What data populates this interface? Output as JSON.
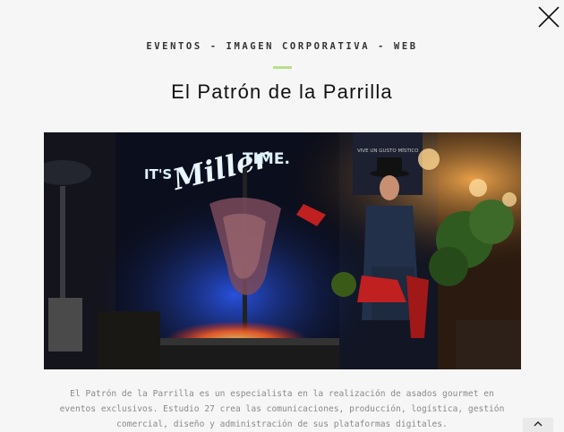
{
  "header": {
    "category": "EVENTOS - IMAGEN CORPORATIVA - WEB",
    "title": "El Patrón de la Parrilla"
  },
  "photo": {
    "neon_sign_line1": "IT'S",
    "neon_sign_line2": "Miller",
    "neon_sign_line3": "TIME.",
    "poster_text": "VIVE UN GUSTO MÍSTICO"
  },
  "description": {
    "line1": "El Patrón de la Parrilla es un especialista en la realización de asados gourmet en",
    "line2": "eventos exclusivos. Estudio 27 crea las comunicaciones, producción, logística, gestión",
    "line3": "comercial, diseño y administración de sus plataformas digitales."
  },
  "controls": {
    "close_icon": "close-icon",
    "scroll_top_icon": "chevron-up-icon"
  },
  "colors": {
    "accent": "#b8e08a",
    "background": "#f6f6f6"
  }
}
